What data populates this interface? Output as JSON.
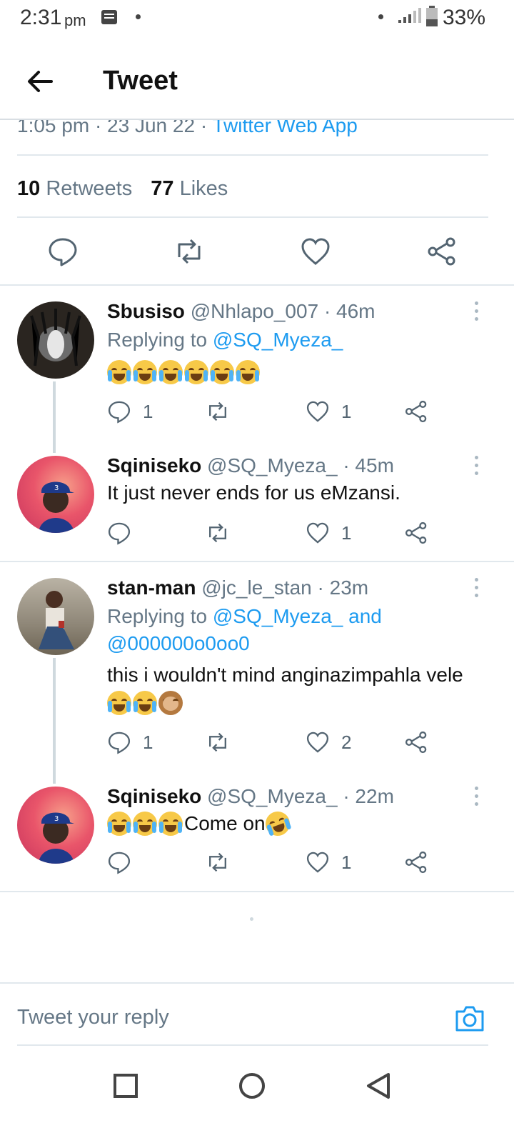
{
  "status_bar": {
    "time": "2:31",
    "ampm": "pm",
    "battery": "33%"
  },
  "header": {
    "title": "Tweet"
  },
  "tweet_meta": {
    "time_date": "1:05 pm · 23 Jun 22 · ",
    "source": "Twitter Web App"
  },
  "stats": {
    "retweets_count": "10",
    "retweets_label": "Retweets",
    "likes_count": "77",
    "likes_label": "Likes"
  },
  "replies": [
    {
      "name": "Sbusiso",
      "handle": "@Nhlapo_007",
      "time": "· 46m",
      "replying_label": "Replying to",
      "replying_to": "@SQ_Myeza_",
      "text": "",
      "reply_count": "1",
      "like_count": "1"
    },
    {
      "name": "Sqiniseko",
      "handle": "@SQ_Myeza_",
      "time": "· 45m",
      "text": "It just never ends for us eMzansi.",
      "reply_count": "",
      "like_count": "1"
    },
    {
      "name": "stan-man",
      "handle": "@jc_le_stan",
      "time": "· 23m",
      "replying_label": "Replying to",
      "replying_to": "@SQ_Myeza_ and",
      "replying_to2": "@000000o0oo0",
      "text": "this i wouldn't mind anginazimpahla vele",
      "reply_count": "1",
      "like_count": "2"
    },
    {
      "name": "Sqiniseko",
      "handle": "@SQ_Myeza_",
      "time": "· 22m",
      "text": "Come on",
      "reply_count": "",
      "like_count": "1"
    }
  ],
  "composer": {
    "placeholder": "Tweet your reply"
  },
  "colors": {
    "accent": "#1d9bf0",
    "muted": "#657786",
    "divider": "#e1e8ed"
  }
}
